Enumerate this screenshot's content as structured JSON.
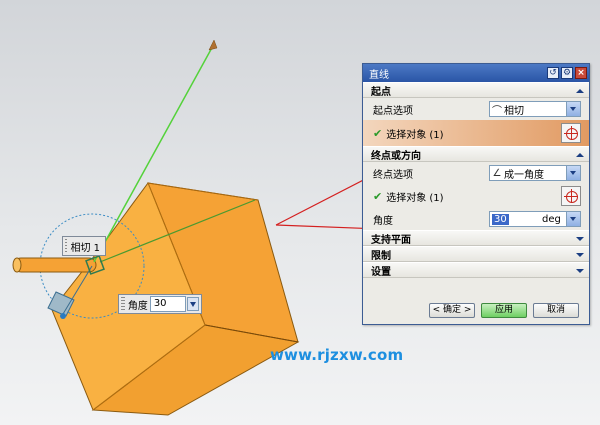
{
  "viewport": {
    "tags": {
      "tangent_label": "相切 1",
      "angle_label": "角度",
      "angle_value": "30"
    }
  },
  "watermark": "www.rjzxw.com",
  "dialog": {
    "title": "直线",
    "titlebar_icons": [
      "reset-icon",
      "settings-icon",
      "close-icon"
    ],
    "sections": {
      "start": {
        "header": "起点",
        "option_label": "起点选项",
        "option_value": "相切",
        "select_label": "选择对象 (1)"
      },
      "end": {
        "header": "终点或方向",
        "option_label": "终点选项",
        "option_value": "成一角度",
        "select_label": "选择对象 (1)",
        "angle_label": "角度",
        "angle_value": "30",
        "angle_unit": "deg"
      },
      "support_plane": {
        "header": "支持平面"
      },
      "limits": {
        "header": "限制"
      },
      "settings": {
        "header": "设置"
      }
    },
    "buttons": {
      "ok": "< 确定 >",
      "apply": "应用",
      "cancel": "取消"
    }
  },
  "colors": {
    "box_fill": "#f7a83a",
    "active_row": "#e0a070",
    "guide_line": "#54d23a",
    "arrow_red": "#d42020",
    "title_bar": "#2f5ea9"
  }
}
